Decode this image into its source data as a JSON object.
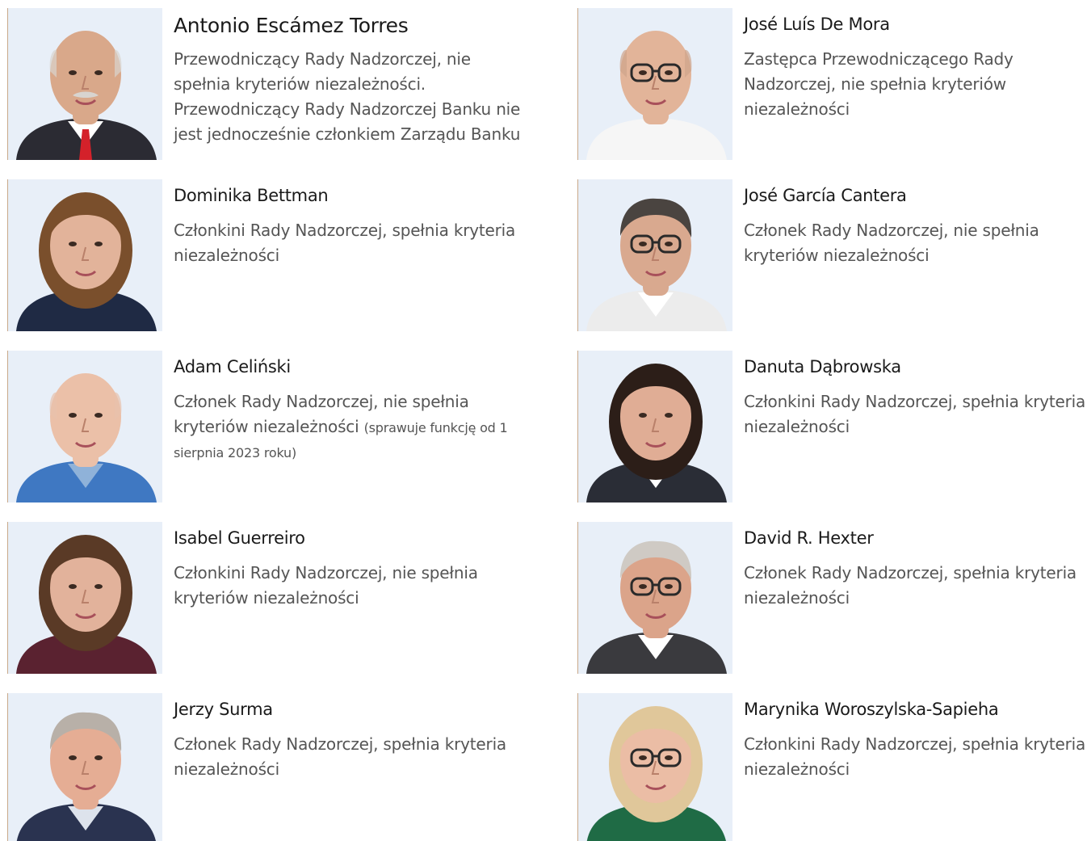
{
  "members": [
    {
      "name": "Antonio Escámez Torres",
      "role": "Przewodniczący Rady Nadzorczej, nie spełnia kryteriów niezależności. Przewodniczący Rady Nadzorczej Banku nie jest jednocześnie członkiem Zarządu Banku",
      "note": "",
      "photo": {
        "hair": "#d8d4cf",
        "skin": "#d9a88a",
        "shirt": "#ffffff",
        "jacket": "#2b2b33",
        "tie": "#d4212a",
        "glasses": false,
        "bald": true,
        "mustache": true
      }
    },
    {
      "name": "José Luís De Mora",
      "role": "Zastępca Przewodniczącego Rady Nadzorczej, nie spełnia kryteriów niezależności",
      "note": "",
      "photo": {
        "hair": "#cfa48a",
        "skin": "#e2b499",
        "shirt": "#f6f6f6",
        "jacket": "#f6f6f6",
        "tie": "",
        "glasses": true,
        "bald": true,
        "mustache": false
      }
    },
    {
      "name": "Dominika Bettman",
      "role": "Członkini Rady Nadzorczej, spełnia kryteria niezależności",
      "note": "",
      "photo": {
        "hair": "#7a4f2c",
        "skin": "#e2b39a",
        "shirt": "#1f2a44",
        "jacket": "#1f2a44",
        "tie": "",
        "glasses": false,
        "bald": false,
        "mustache": false
      }
    },
    {
      "name": "José García Cantera",
      "role": "Członek Rady Nadzorczej, nie spełnia kryteriów niezależności",
      "note": "",
      "photo": {
        "hair": "#4a4440",
        "skin": "#d9a98f",
        "shirt": "#ffffff",
        "jacket": "#ececec",
        "tie": "",
        "glasses": true,
        "bald": false,
        "mustache": false
      }
    },
    {
      "name": "Adam Celiński",
      "role": "Członek Rady Nadzorczej, nie spełnia kryteriów niezależności",
      "note": "(sprawuje funkcję od 1 sierpnia 2023 roku)",
      "photo": {
        "hair": "#e8c2ad",
        "skin": "#ebc0a8",
        "shirt": "#8fb2d9",
        "jacket": "#3f78c2",
        "tie": "",
        "glasses": false,
        "bald": true,
        "mustache": false
      }
    },
    {
      "name": "Danuta Dąbrowska",
      "role": "Członkini Rady Nadzorczej, spełnia kryteria niezależności",
      "note": "",
      "photo": {
        "hair": "#2c1e18",
        "skin": "#e0ad95",
        "shirt": "#ffffff",
        "jacket": "#2a2d36",
        "tie": "",
        "glasses": false,
        "bald": false,
        "mustache": false
      }
    },
    {
      "name": "Isabel Guerreiro",
      "role": "Członkini Rady Nadzorczej, nie spełnia kryteriów niezależności",
      "note": "",
      "photo": {
        "hair": "#5a3a26",
        "skin": "#e2b29b",
        "shirt": "#5a2230",
        "jacket": "#5a2230",
        "tie": "",
        "glasses": false,
        "bald": false,
        "mustache": false
      }
    },
    {
      "name": "David R. Hexter",
      "role": "Członek Rady Nadzorczej, spełnia kryteria niezależności",
      "note": "",
      "photo": {
        "hair": "#cfcac4",
        "skin": "#dba48a",
        "shirt": "#ffffff",
        "jacket": "#3a3a3e",
        "tie": "",
        "glasses": true,
        "bald": false,
        "mustache": false
      }
    },
    {
      "name": "Jerzy Surma",
      "role": "Członek Rady Nadzorczej, spełnia kryteria niezależności",
      "note": "",
      "photo": {
        "hair": "#b8b0a8",
        "skin": "#e5ad94",
        "shirt": "#dde3ec",
        "jacket": "#2a3350",
        "tie": "",
        "glasses": false,
        "bald": false,
        "mustache": false
      }
    },
    {
      "name": "Marynika Woroszylska-Sapieha",
      "role": "Członkini Rady Nadzorczej, spełnia kryteria niezależności",
      "note": "",
      "photo": {
        "hair": "#e0c79a",
        "skin": "#ebbda5",
        "shirt": "#1f6b45",
        "jacket": "#1f6b45",
        "tie": "",
        "glasses": true,
        "bald": false,
        "mustache": false
      }
    }
  ]
}
